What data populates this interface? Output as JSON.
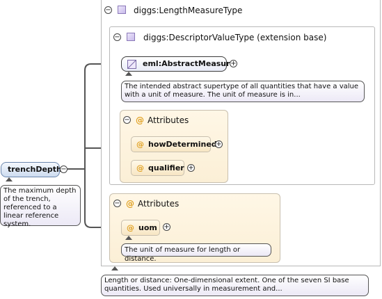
{
  "root_element": {
    "name": "trenchDepth",
    "doc": "The maximum depth of the trench, referenced to a linear reference system."
  },
  "type": {
    "name": "diggs:LengthMeasureType",
    "doc": "Length or distance: One-dimensional extent. One of the seven SI base quantities. Used universally in measurement and..."
  },
  "base_type": {
    "name": "diggs:DescriptorValueType (extension base)"
  },
  "abstract_measure": {
    "name": "eml:AbstractMeasure",
    "doc": "The intended abstract supertype of all quantities that have a value with a unit of measure. The unit of measure is in..."
  },
  "attributes_label": "Attributes",
  "base_attributes": [
    "howDetermined",
    "qualifier"
  ],
  "uom_attribute": {
    "name": "uom",
    "doc": "The unit of measure for length or distance."
  },
  "symbols": {
    "at": "@",
    "collapse": "−",
    "expand": "+"
  }
}
